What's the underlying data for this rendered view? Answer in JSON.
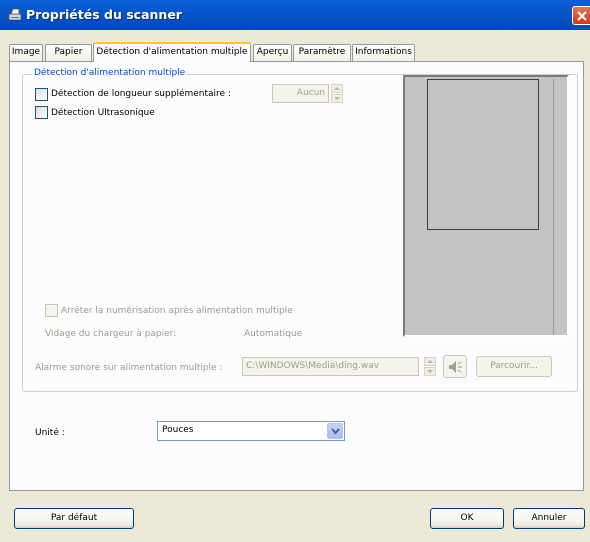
{
  "window": {
    "title": "Propriétés du scanner"
  },
  "tabs": [
    {
      "label": "Image"
    },
    {
      "label": "Papier"
    },
    {
      "label": "Détection d'alimentation multiple",
      "active": true
    },
    {
      "label": "Aperçu"
    },
    {
      "label": "Paramètre"
    },
    {
      "label": "Informations"
    }
  ],
  "group": {
    "title": "Détection d'alimentation multiple",
    "extra_length": {
      "label": "Détection de longueur supplémentaire :",
      "checked": false,
      "value": "Aucun"
    },
    "ultrasonic": {
      "label": "Détection Ultrasonique",
      "checked": false
    },
    "stop_scan": {
      "label": "Arrêter la numérisation après alimentation multiple",
      "checked": false
    },
    "feeder_empty": {
      "label": "Vidage du chargeur à papier:",
      "value": "Automatique"
    },
    "alarm": {
      "label": "Alarme sonore sur alimentation multiple :",
      "path": "C:\\WINDOWS\\Media\\ding.wav",
      "browse_label": "Parcourir..."
    }
  },
  "unit": {
    "label": "Unité :",
    "value": "Pouces"
  },
  "buttons": {
    "default_label": "Par défaut",
    "ok_label": "OK",
    "cancel_label": "Annuler"
  },
  "colors": {
    "titlebar": "#0a5fd8",
    "group_title": "#0046d5",
    "active_tab_highlight": "#ffc83c"
  },
  "icons": {
    "window": "scanner-icon",
    "close": "close-icon",
    "speaker": "speaker-icon",
    "dropdown": "chevron-down-icon"
  }
}
